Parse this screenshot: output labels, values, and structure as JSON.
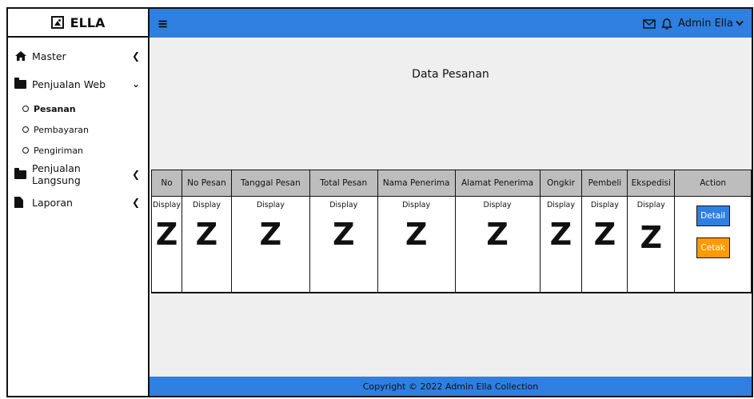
{
  "brand": {
    "name": "ELLA"
  },
  "sidebar": {
    "items": [
      {
        "label": "Master",
        "chevron": "<"
      },
      {
        "label": "Penjualan Web",
        "chevron": "v",
        "children": [
          {
            "label": "Pesanan",
            "active": true
          },
          {
            "label": "Pembayaran",
            "active": false
          },
          {
            "label": "Pengiriman",
            "active": false
          }
        ]
      },
      {
        "label": "Penjualan Langsung",
        "chevron": "<"
      },
      {
        "label": "Laporan",
        "chevron": "<"
      }
    ]
  },
  "topbar": {
    "menu_icon": "hamburger-icon",
    "user_label": "Admin Ella"
  },
  "main": {
    "title": "Data Pesanan"
  },
  "table": {
    "columns": [
      "No",
      "No Pesan",
      "Tanggal Pesan",
      "Total Pesan",
      "Nama Penerima",
      "Alamat Penerima",
      "Ongkir",
      "Pembeli",
      "Ekspedisi",
      "Action"
    ],
    "cell_label": "Display",
    "cell_glyph": "Z",
    "actions": {
      "detail": "Detail",
      "cetak": "Cetak"
    }
  },
  "footer": {
    "text": "Copyright © 2022 Admin Ella Collection"
  },
  "colors": {
    "accent": "#2f7fe0",
    "header": "#bdbdbd",
    "cetak": "#ff9a00",
    "content_bg": "#efefef"
  }
}
